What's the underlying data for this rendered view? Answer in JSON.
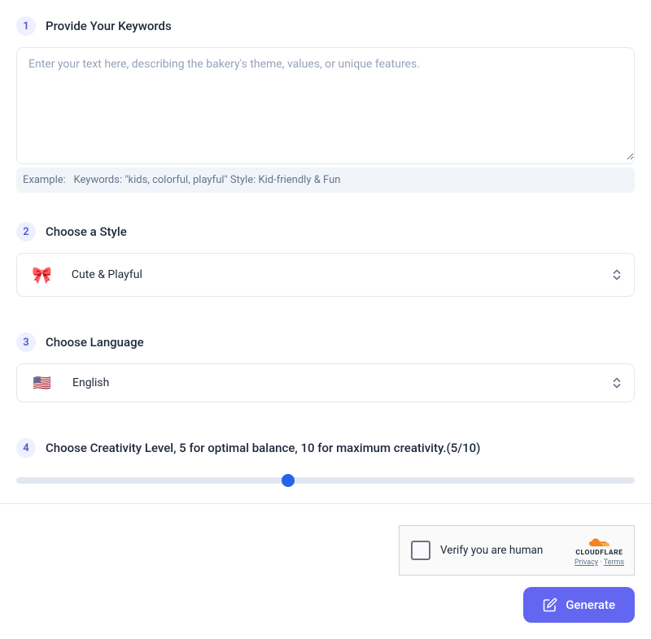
{
  "step1": {
    "number": "1",
    "title": "Provide Your Keywords",
    "placeholder": "Enter your text here, describing the bakery's theme, values, or unique features.",
    "example_prefix": "Example:",
    "example_text": "Keywords: \"kids, colorful, playful\" Style: Kid-friendly & Fun"
  },
  "step2": {
    "number": "2",
    "title": "Choose a Style",
    "selected_emoji": "🎀",
    "selected_label": "Cute & Playful"
  },
  "step3": {
    "number": "3",
    "title": "Choose Language",
    "selected_flag": "🇺🇸",
    "selected_label": "English"
  },
  "step4": {
    "number": "4",
    "title": "Choose Creativity Level, 5 for optimal balance, 10 for maximum creativity.(5/10)",
    "value": 5,
    "min": 0,
    "max": 10,
    "thumb_percent": "44%"
  },
  "captcha": {
    "text": "Verify you are human",
    "brand": "CLOUDFLARE",
    "privacy": "Privacy",
    "terms": "Terms",
    "dot": "·"
  },
  "generate": {
    "label": "Generate"
  }
}
